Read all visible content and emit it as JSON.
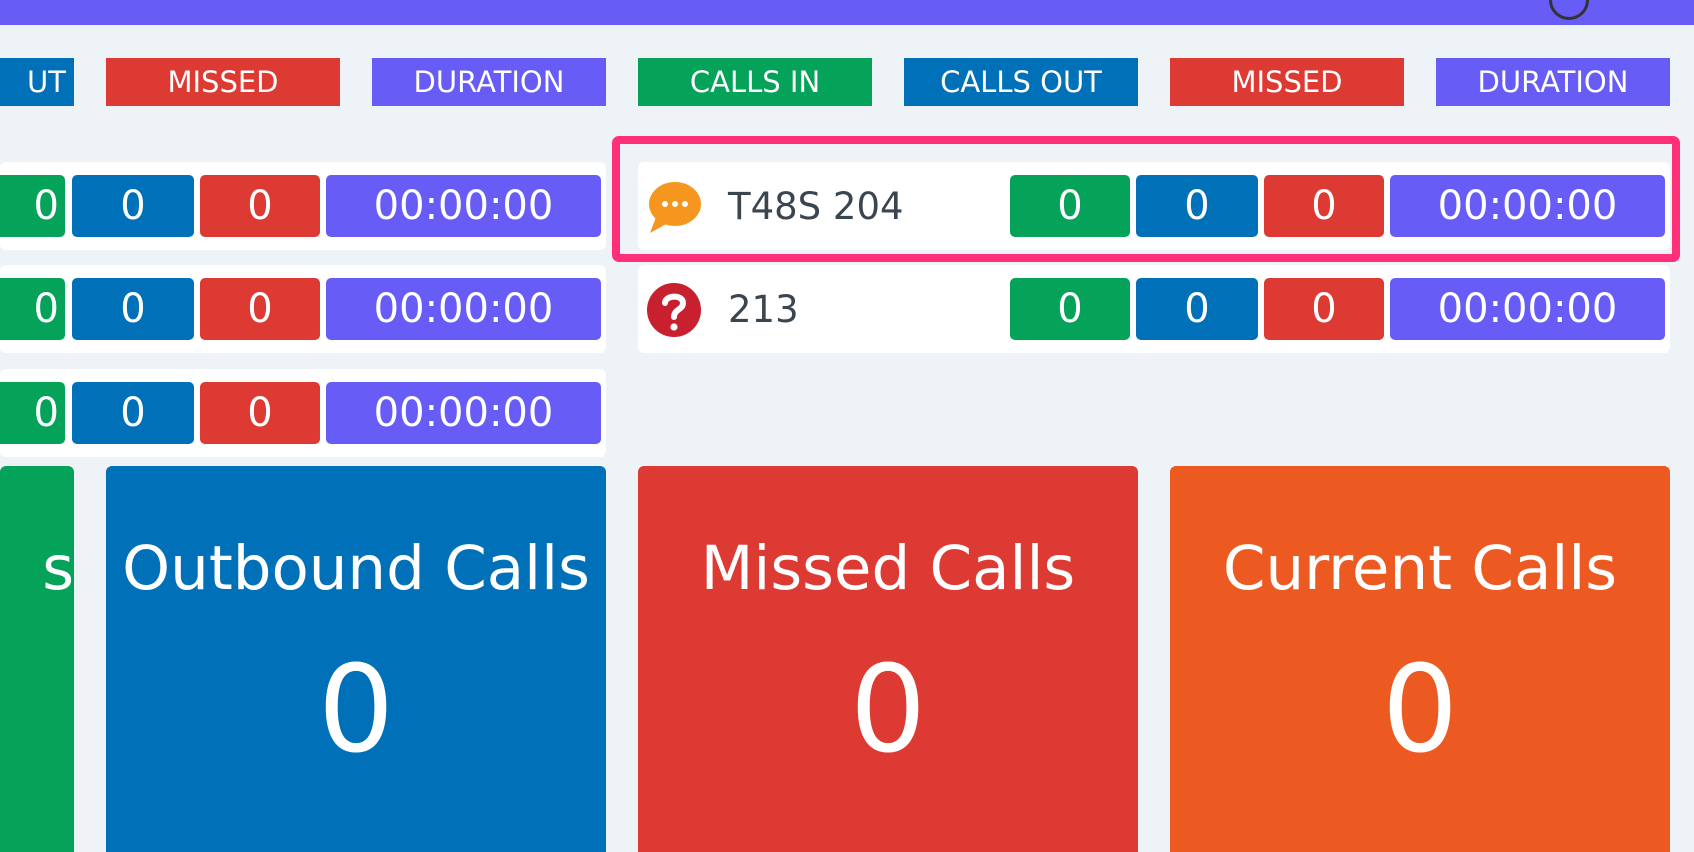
{
  "colors": {
    "calls_in": "#05a35a",
    "calls_out": "#0070b8",
    "missed": "#dd3a33",
    "duration": "#685cf6",
    "current": "#ec5a22",
    "highlight": "#ff2f78",
    "header_bar": "#685cf6"
  },
  "left_group": {
    "headers": {
      "calls_out": "UT",
      "missed": "MISSED",
      "duration": "DURATION"
    },
    "rows": [
      {
        "calls_in": "0",
        "calls_out": "0",
        "missed": "0",
        "duration": "00:00:00"
      },
      {
        "calls_in": "0",
        "calls_out": "0",
        "missed": "0",
        "duration": "00:00:00"
      },
      {
        "calls_in": "0",
        "calls_out": "0",
        "missed": "0",
        "duration": "00:00:00"
      }
    ]
  },
  "right_group": {
    "headers": {
      "calls_in": "CALLS IN",
      "calls_out": "CALLS OUT",
      "missed": "MISSED",
      "duration": "DURATION"
    },
    "rows": [
      {
        "name": "T48S 204",
        "status_icon": "chat-bubble-icon",
        "calls_in": "0",
        "calls_out": "0",
        "missed": "0",
        "duration": "00:00:00",
        "highlighted": true
      },
      {
        "name": "213",
        "status_icon": "question-icon",
        "calls_in": "0",
        "calls_out": "0",
        "missed": "0",
        "duration": "00:00:00",
        "highlighted": false
      }
    ]
  },
  "summary_tiles": {
    "inbound": {
      "title": "s"
    },
    "outbound": {
      "title": "Outbound Calls",
      "value": "0"
    },
    "missed": {
      "title": "Missed Calls",
      "value": "0"
    },
    "current": {
      "title": "Current Calls",
      "value": "0"
    }
  }
}
